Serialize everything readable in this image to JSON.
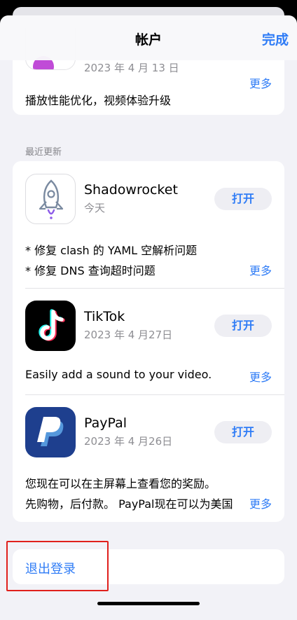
{
  "header": {
    "title": "帐户",
    "done_label": "完成"
  },
  "top_card": {
    "date": "2023 年 4 月 13 日",
    "description": "播放性能优化，视频体验升级",
    "more": "更多"
  },
  "section": {
    "label": "最近更新"
  },
  "apps": [
    {
      "name": "Shadowrocket",
      "subtitle": "今天",
      "button": "打开",
      "icon": "shadowrocket-rocket-icon",
      "notes": [
        "* 修复 clash 的 YAML 空解析问题",
        "* 修复 DNS 查询超时问题"
      ],
      "more": "更多"
    },
    {
      "name": "TikTok",
      "subtitle": "2023 年 4 月27日",
      "button": "打开",
      "icon": "tiktok-note-icon",
      "notes": [
        "Easily add a sound to your video."
      ],
      "more": "更多"
    },
    {
      "name": "PayPal",
      "subtitle": "2023 年 4 月26日",
      "button": "打开",
      "icon": "paypal-p-icon",
      "notes": [
        "您现在可以在主屏幕上查看您的奖励。",
        "先购物，后付款。 PayPal现在可以为美国"
      ],
      "more": "更多"
    }
  ],
  "logout": {
    "label": "退出登录"
  },
  "colors": {
    "accent": "#2f7cf6",
    "highlight": "#e0201c"
  }
}
